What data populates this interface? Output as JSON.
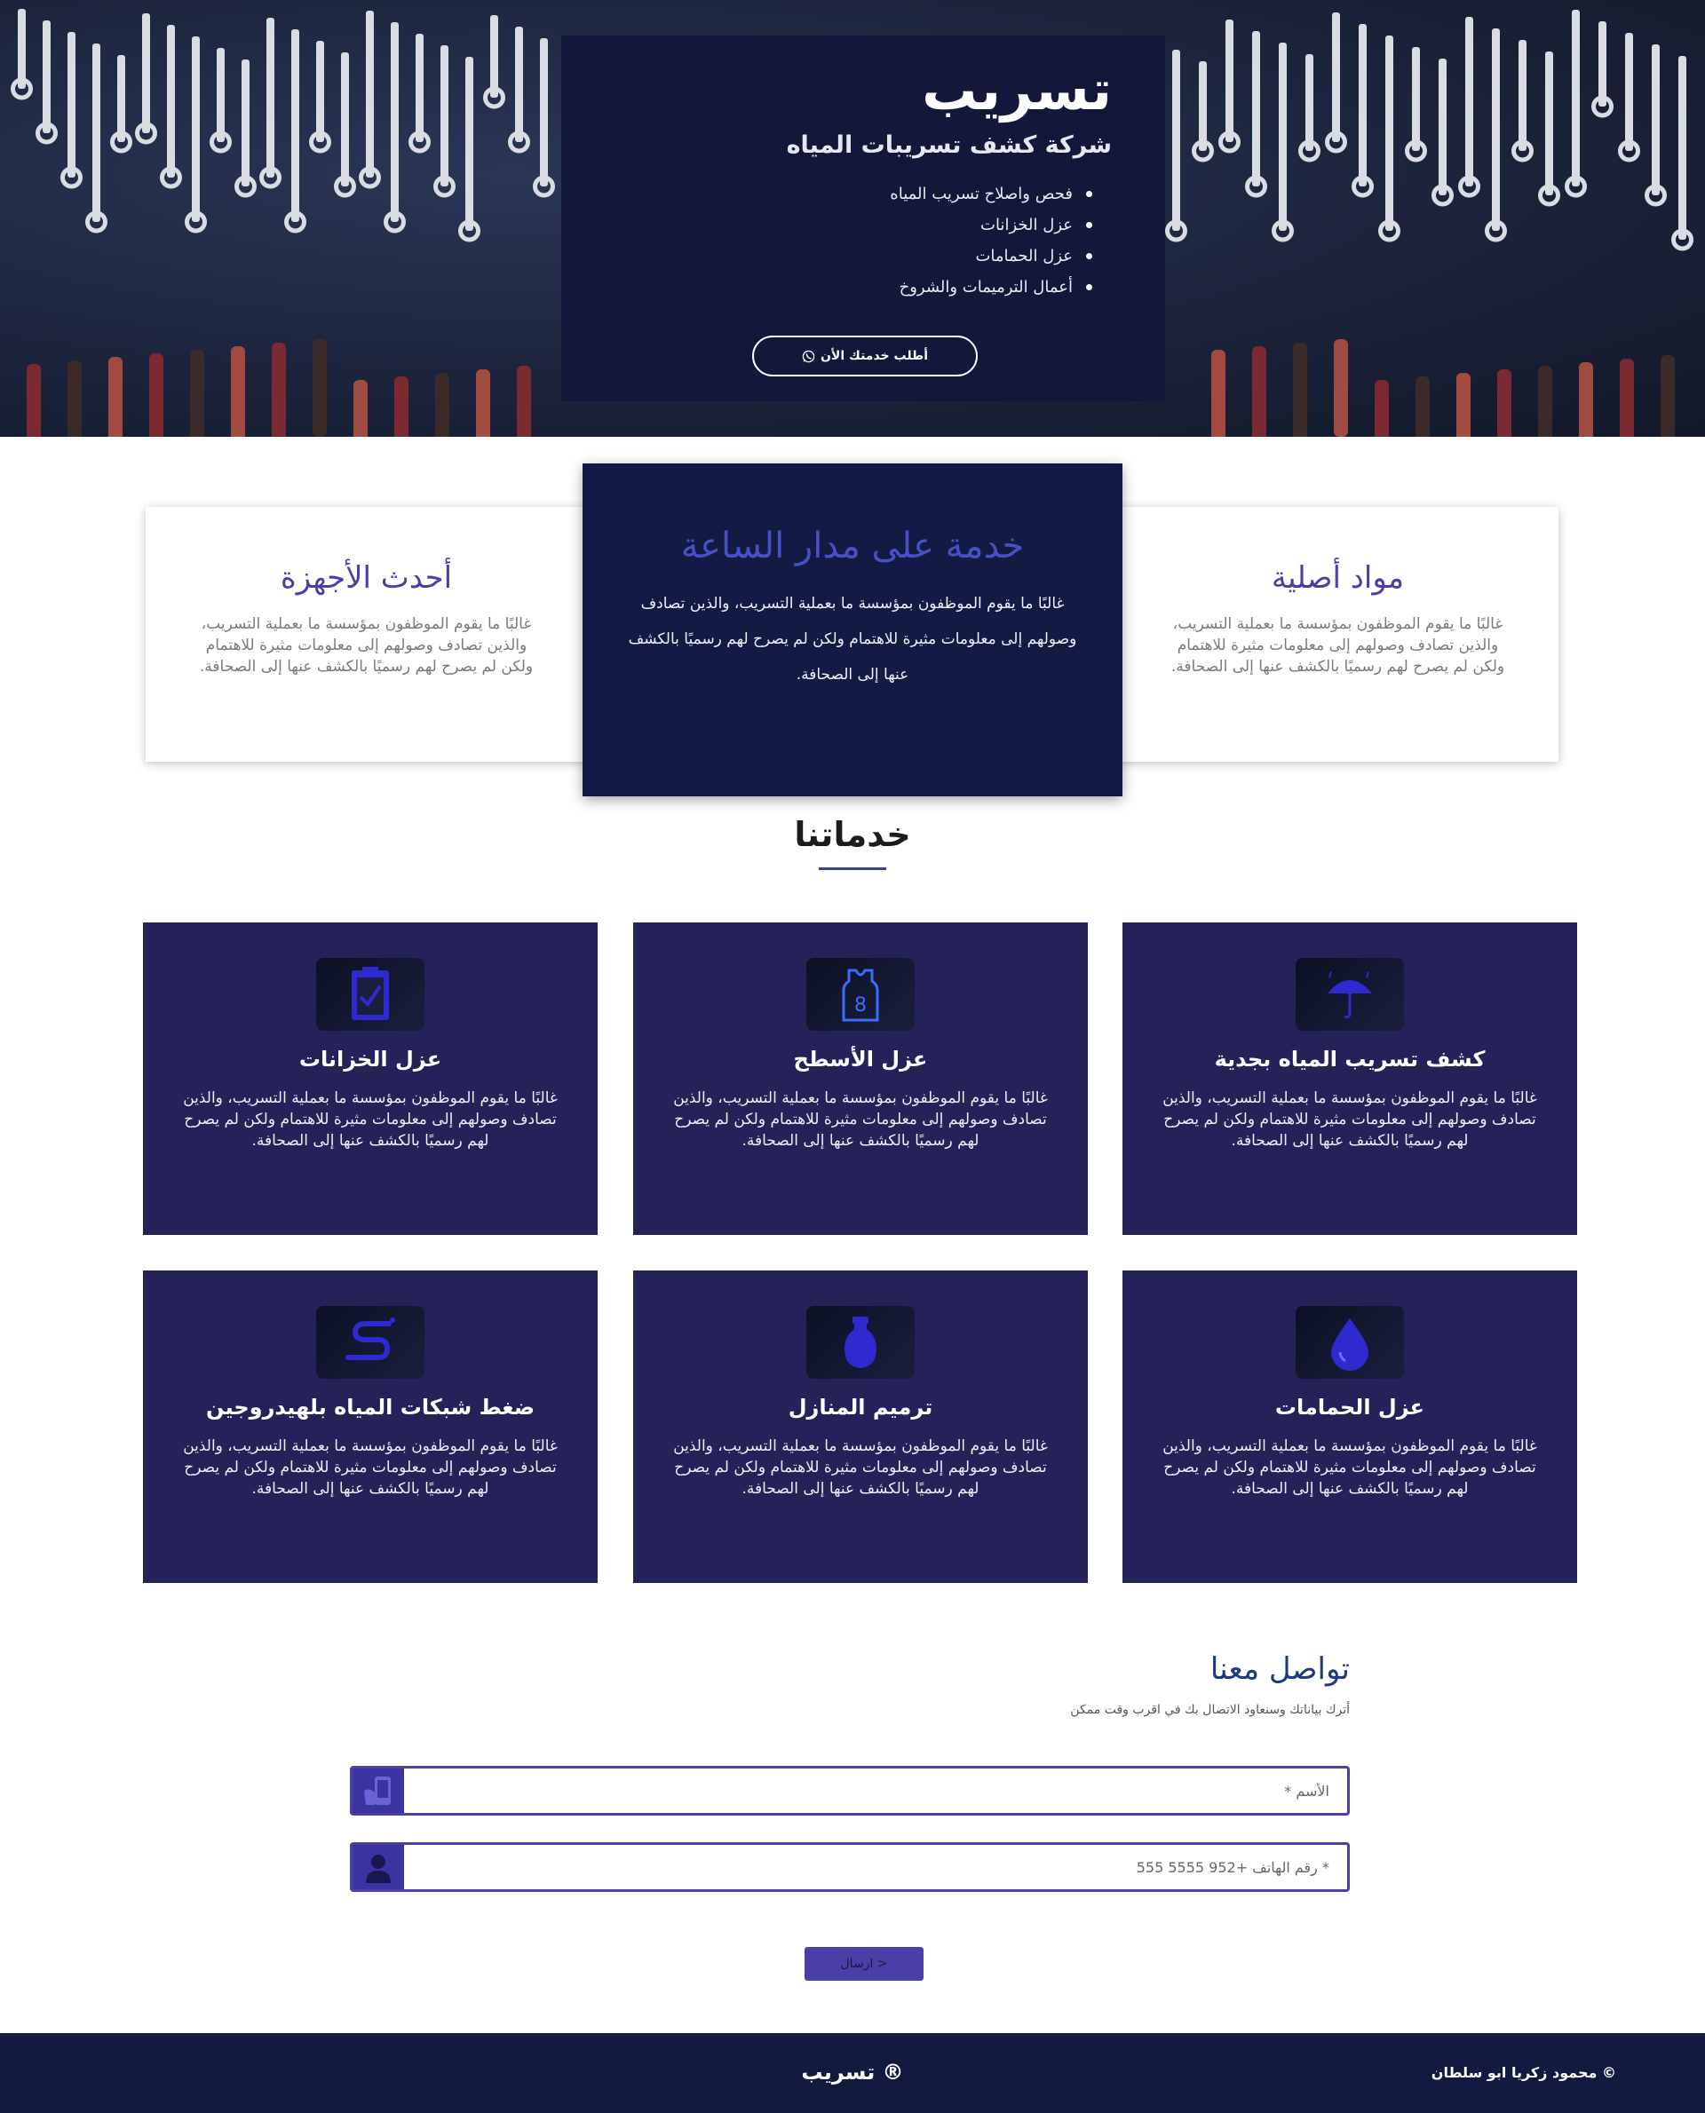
{
  "hero": {
    "title": "تسريب",
    "subtitle": "شركة كشف تسريبات المياه",
    "items": [
      "فحص واصلاح تسريب المياه",
      "عزل الخزانات",
      "عزل الحمامات",
      "أعمال الترميمات والشروخ"
    ],
    "cta_label": "أطلب خدمتك الأن",
    "cta_icon": "whatsapp-icon"
  },
  "features": {
    "right": {
      "title": "مواد أصلية",
      "text": "غالبًا ما يقوم الموظفون بمؤسسة ما بعملية التسريب، والذين تصادف وصولهم إلى معلومات مثيرة للاهتمام ولكن لم يصرح لهم رسميًا بالكشف عنها إلى الصحافة."
    },
    "center": {
      "title": "خدمة على مدار الساعة",
      "text": "غالبًا ما يقوم الموظفون بمؤسسة ما بعملية التسريب، والذين تصادف وصولهم إلى معلومات مثيرة للاهتمام ولكن لم يصرح لهم رسميًا بالكشف عنها إلى الصحافة."
    },
    "left": {
      "title": "أحدث الأجهزة",
      "text": "غالبًا ما يقوم الموظفون بمؤسسة ما بعملية التسريب، والذين تصادف وصولهم إلى معلومات مثيرة للاهتمام ولكن لم يصرح لهم رسميًا بالكشف عنها إلى الصحافة."
    }
  },
  "services": {
    "title": "خدماتنا",
    "items": [
      {
        "title": "كشف تسريب المياه بجدية",
        "text": "غالبًا ما يقوم الموظفون بمؤسسة ما بعملية التسريب، والذين تصادف وصولهم إلى معلومات مثيرة للاهتمام ولكن لم يصرح لهم رسميًا بالكشف عنها إلى الصحافة.",
        "icon": "umbrella-rain-icon"
      },
      {
        "title": "عزل الأسطح",
        "text": "غالبًا ما يقوم الموظفون بمؤسسة ما بعملية التسريب، والذين تصادف وصولهم إلى معلومات مثيرة للاهتمام ولكن لم يصرح لهم رسميًا بالكشف عنها إلى الصحافة.",
        "icon": "jersey-icon"
      },
      {
        "title": "عزل الخزانات",
        "text": "غالبًا ما يقوم الموظفون بمؤسسة ما بعملية التسريب، والذين تصادف وصولهم إلى معلومات مثيرة للاهتمام ولكن لم يصرح لهم رسميًا بالكشف عنها إلى الصحافة.",
        "icon": "clipboard-check-icon"
      },
      {
        "title": "عزل الحمامات",
        "text": "غالبًا ما يقوم الموظفون بمؤسسة ما بعملية التسريب، والذين تصادف وصولهم إلى معلومات مثيرة للاهتمام ولكن لم يصرح لهم رسميًا بالكشف عنها إلى الصحافة.",
        "icon": "water-drop-icon"
      },
      {
        "title": "ترميم المنازل",
        "text": "غالبًا ما يقوم الموظفون بمؤسسة ما بعملية التسريب، والذين تصادف وصولهم إلى معلومات مثيرة للاهتمام ولكن لم يصرح لهم رسميًا بالكشف عنها إلى الصحافة.",
        "icon": "vase-icon"
      },
      {
        "title": "ضغط شبكات المياه بلهيدروجين",
        "text": "غالبًا ما يقوم الموظفون بمؤسسة ما بعملية التسريب، والذين تصادف وصولهم إلى معلومات مثيرة للاهتمام ولكن لم يصرح لهم رسميًا بالكشف عنها إلى الصحافة.",
        "icon": "hose-icon"
      }
    ]
  },
  "contact": {
    "title": "تواصل معنا",
    "subtitle": "أترك بياناتك وسنعاود الاتصال بك في اقرب وقت ممكن",
    "name_placeholder": "الأسم *",
    "phone_placeholder": "* رقم الهاتف +952 5555 555",
    "send_label": "< ارسال"
  },
  "footer": {
    "brand": "® تسريب",
    "copyright": "© محمود زكريا ابو سلطان"
  },
  "colors": {
    "navy": "#13183a",
    "service_bg": "#252159",
    "accent": "#4a3fa8",
    "footer": "#121a40"
  }
}
